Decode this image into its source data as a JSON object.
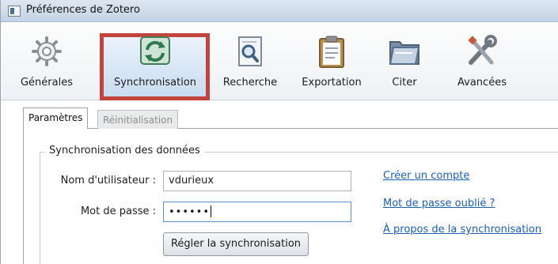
{
  "window": {
    "title": "Préférences de Zotero"
  },
  "toolbar": {
    "items": [
      {
        "label": "Générales",
        "icon": "gear-icon"
      },
      {
        "label": "Synchronisation",
        "icon": "sync-icon",
        "selected": true
      },
      {
        "label": "Recherche",
        "icon": "magnifier-icon"
      },
      {
        "label": "Exportation",
        "icon": "clipboard-icon"
      },
      {
        "label": "Citer",
        "icon": "folder-icon"
      },
      {
        "label": "Avancées",
        "icon": "tools-icon"
      }
    ]
  },
  "tabs": {
    "items": [
      {
        "label": "Paramètres",
        "active": true
      },
      {
        "label": "Réinitialisation",
        "active": false
      }
    ]
  },
  "sync_group": {
    "title": "Synchronisation des données",
    "username_label": "Nom d'utilisateur :",
    "username_value": "vdurieux",
    "password_label": "Mot de passe :",
    "password_value": "••••••",
    "setup_button": "Régler la synchronisation"
  },
  "links": {
    "create_account": "Créer un compte",
    "forgot_password": "Mot de passe oublié ?",
    "about_sync": "À propos de la synchronisation"
  },
  "colors": {
    "highlight_border": "#c1453d",
    "link": "#1a5fb4",
    "selected_bg": "#c9dcf1"
  }
}
